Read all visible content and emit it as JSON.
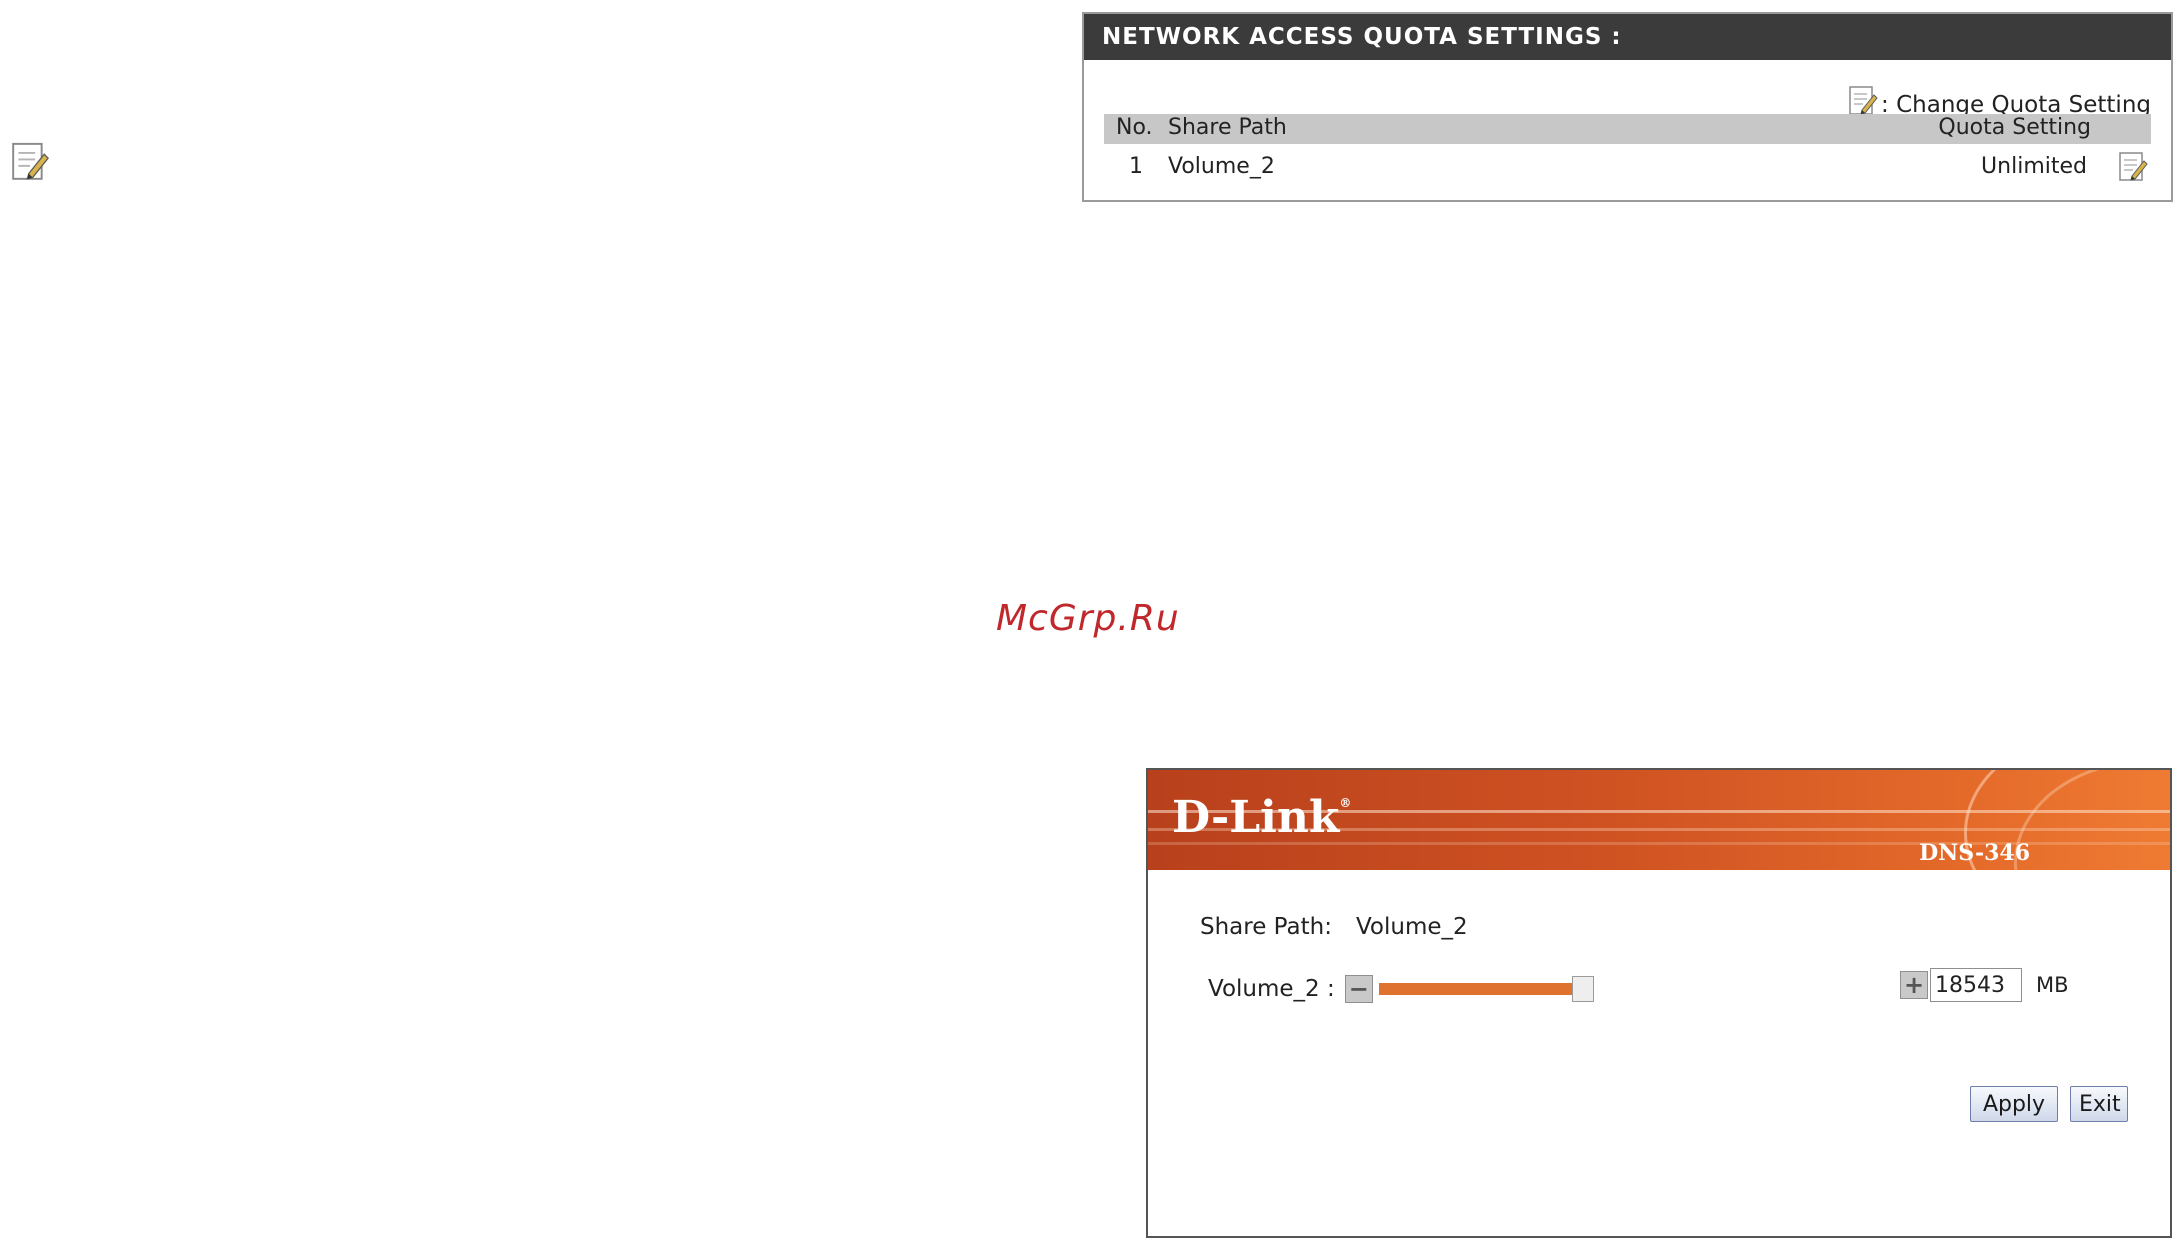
{
  "quota_panel": {
    "title": "NETWORK ACCESS QUOTA SETTINGS :",
    "legend_text": ": Change Quota Setting",
    "columns": {
      "no": "No.",
      "share_path": "Share Path",
      "quota_setting": "Quota Setting"
    },
    "rows": [
      {
        "no": "1",
        "share_path": "Volume_2",
        "quota": "Unlimited"
      }
    ]
  },
  "watermark": "McGrp.Ru",
  "dialog": {
    "brand": "D-Link",
    "model": "DNS-346",
    "share_path_label": "Share Path:",
    "share_path_value": "Volume_2",
    "volume_label": "Volume_2 :",
    "quota_value": "18543",
    "unit": "MB",
    "slider_level": 0.9,
    "apply_label": "Apply",
    "exit_label": "Exit"
  },
  "icons": {
    "edit": "edit-note-icon",
    "minus": "minus-icon",
    "plus": "plus-icon"
  },
  "colors": {
    "panel_header": "#3b3b3b",
    "table_header": "#c7c7c7",
    "banner_orange": "#cf5222",
    "slider_fill": "#e07230",
    "watermark": "#c0282c"
  }
}
